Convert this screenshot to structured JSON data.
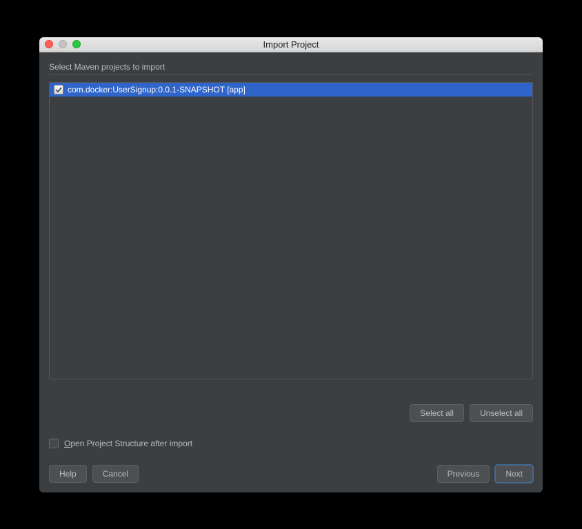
{
  "window": {
    "title": "Import Project"
  },
  "heading": "Select Maven projects to import",
  "projects": [
    {
      "label": "com.docker:UserSignup:0.0.1-SNAPSHOT [app]",
      "checked": true,
      "selected": true
    }
  ],
  "buttons": {
    "select_all": "Select all",
    "unselect_all": "Unselect all",
    "help": "Help",
    "cancel": "Cancel",
    "previous": "Previous",
    "next": "Next"
  },
  "options": {
    "open_project_structure_prefix": "O",
    "open_project_structure_rest": "pen Project Structure after import",
    "open_project_structure_checked": false
  }
}
